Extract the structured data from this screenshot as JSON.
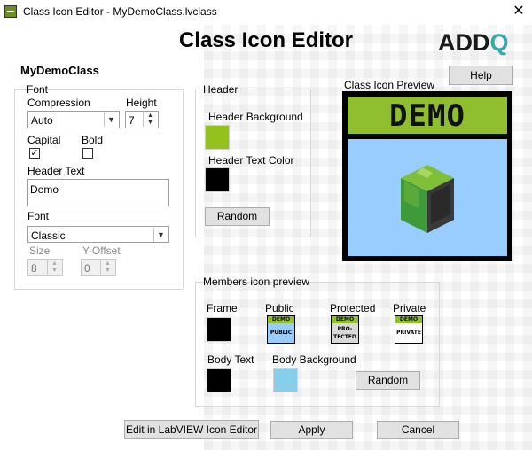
{
  "window": {
    "title": "Class Icon Editor - MyDemoClass.lvclass",
    "close_glyph": "✕"
  },
  "heading": "Class Icon Editor",
  "logo": {
    "main": "ADD",
    "accent": "Q"
  },
  "class_name": "MyDemoClass",
  "help_button": "Help",
  "font_group": {
    "label": "Font",
    "compression_label": "Compression",
    "compression_value": "Auto",
    "height_label": "Height",
    "height_value": "7",
    "capital_label": "Capital",
    "capital_checked": true,
    "capital_mark": "✓",
    "bold_label": "Bold",
    "bold_checked": false,
    "header_text_label": "Header Text",
    "header_text_value": "Demo",
    "font_label": "Font",
    "font_value": "Classic",
    "size_label": "Size",
    "size_value": "8",
    "yoffset_label": "Y-Offset",
    "yoffset_value": "0"
  },
  "header_group": {
    "label": "Header",
    "bg_label": "Header Background",
    "bg_color": "#95c11f",
    "text_color_label": "Header Text Color",
    "text_color": "#000000",
    "random_button": "Random"
  },
  "preview": {
    "label": "Class Icon Preview",
    "header_text": "DEMO",
    "header_color": "#8fbf2e",
    "body_color": "#99ccff"
  },
  "members_group": {
    "label": "Members icon preview",
    "frame_label": "Frame",
    "frame_color": "#000000",
    "public_label": "Public",
    "protected_label": "Protected",
    "private_label": "Private",
    "mini_header": "DEMO",
    "public_text": "PUBLIC",
    "protected_text_1": "PRO-",
    "protected_text_2": "TECTED",
    "private_text": "PRIVATE",
    "body_text_label": "Body Text",
    "body_text_color": "#000000",
    "body_bg_label": "Body Background",
    "body_bg_color": "#87ceeb",
    "random_button": "Random"
  },
  "footer": {
    "edit_button": "Edit in LabVIEW Icon Editor",
    "apply_button": "Apply",
    "cancel_button": "Cancel"
  }
}
